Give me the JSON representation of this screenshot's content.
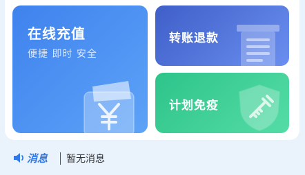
{
  "cards": {
    "recharge": {
      "title": "在线充值",
      "subtitle": "便捷 即时 安全",
      "icon": "wallet-yen-icon"
    },
    "transfer": {
      "title": "转账退款",
      "icon": "ledger-icon"
    },
    "plan": {
      "title": "计划免疫",
      "icon": "vaccine-shield-icon"
    }
  },
  "message_bar": {
    "icon": "speaker-icon",
    "label": "消息",
    "text": "暂无消息"
  },
  "colors": {
    "recharge": "#4a8ff2",
    "transfer": "#5174dc",
    "plan": "#3ecf95",
    "accent": "#2f7ae6"
  }
}
